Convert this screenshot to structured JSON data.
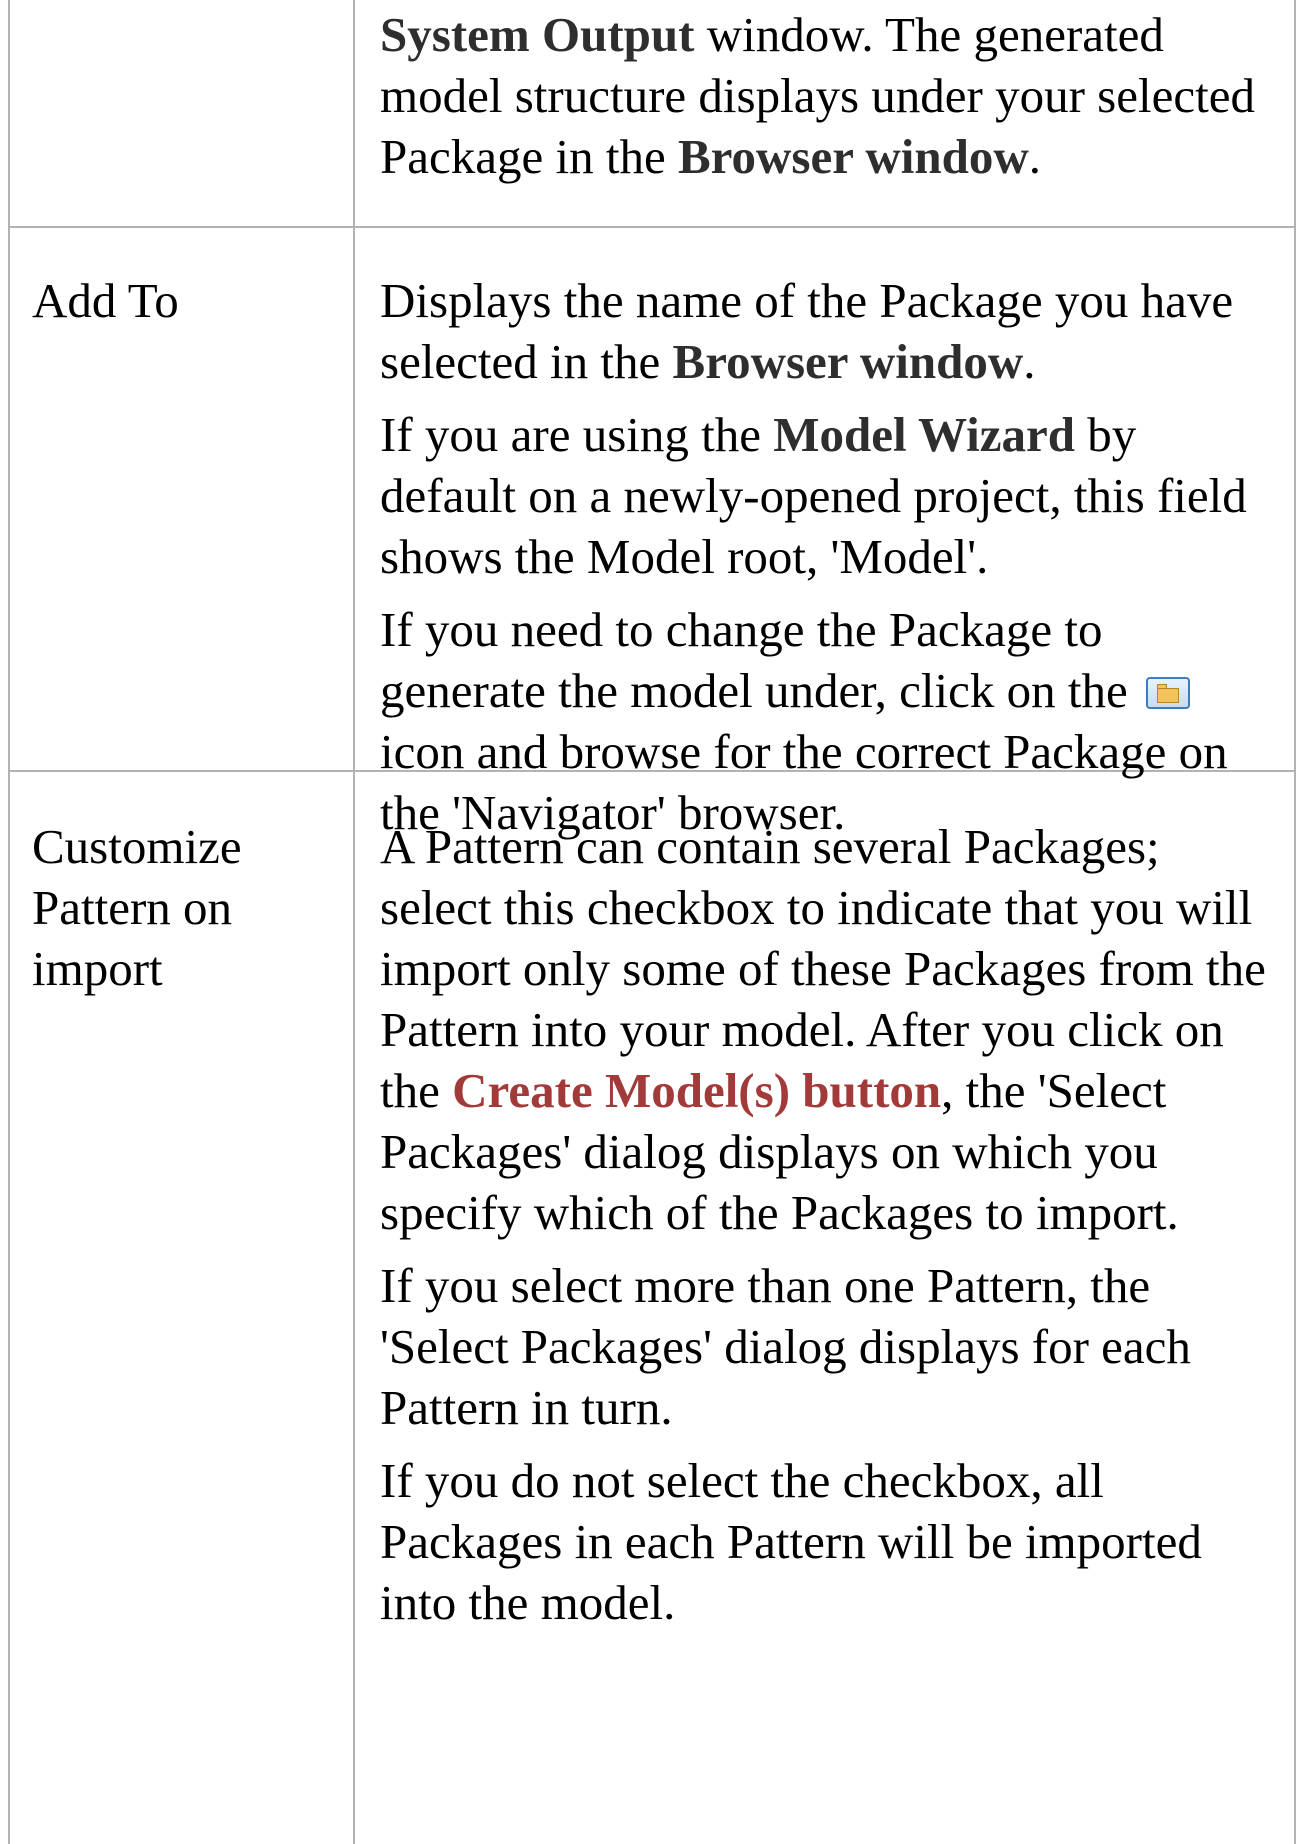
{
  "rows": [
    {
      "label": "",
      "paragraphs": [
        {
          "segments": [
            {
              "text": "System Output",
              "style": "bold"
            },
            {
              "text": " window. The generated model structure displays under your selected Package in the ",
              "style": "normal"
            },
            {
              "text": "Browser window",
              "style": "bold"
            },
            {
              "text": ".",
              "style": "normal"
            }
          ]
        }
      ]
    },
    {
      "label": "Add To",
      "paragraphs": [
        {
          "segments": [
            {
              "text": "Displays the name of the Package you have selected in the ",
              "style": "normal"
            },
            {
              "text": "Browser window",
              "style": "bold"
            },
            {
              "text": ".",
              "style": "normal"
            }
          ]
        },
        {
          "segments": [
            {
              "text": "If you are using the ",
              "style": "normal"
            },
            {
              "text": "Model Wizard",
              "style": "bold"
            },
            {
              "text": " by default on a newly-opened project, this field shows the Model root, 'Model'.",
              "style": "normal"
            }
          ]
        },
        {
          "segments": [
            {
              "text": "If you need to change the Package to generate the model under, click on the ",
              "style": "normal"
            },
            {
              "icon": "folder-browse-icon"
            },
            {
              "text": " icon and browse for the correct Package on the 'Navigator' browser.",
              "style": "normal"
            }
          ]
        }
      ]
    },
    {
      "label": "Customize Pattern on import",
      "paragraphs": [
        {
          "segments": [
            {
              "text": "A Pattern can contain several Packages; select this checkbox to indicate that you will import only some of these Packages from the Pattern into your model. After you click on the ",
              "style": "normal"
            },
            {
              "text": "Create Model(s) button",
              "style": "link"
            },
            {
              "text": ", the 'Select Packages' dialog displays on which you specify which of the Packages to import.",
              "style": "normal"
            }
          ]
        },
        {
          "segments": [
            {
              "text": "If you select more than one Pattern, the 'Select Packages' dialog displays for each Pattern in turn.",
              "style": "normal"
            }
          ]
        },
        {
          "segments": [
            {
              "text": "If you do not select the checkbox, all Packages in each Pattern will be imported into the model.",
              "style": "normal"
            }
          ]
        }
      ]
    }
  ],
  "colors": {
    "border": "#b3b3b3",
    "bold_text": "#2e2e2e",
    "link_text": "#a33a3a"
  }
}
